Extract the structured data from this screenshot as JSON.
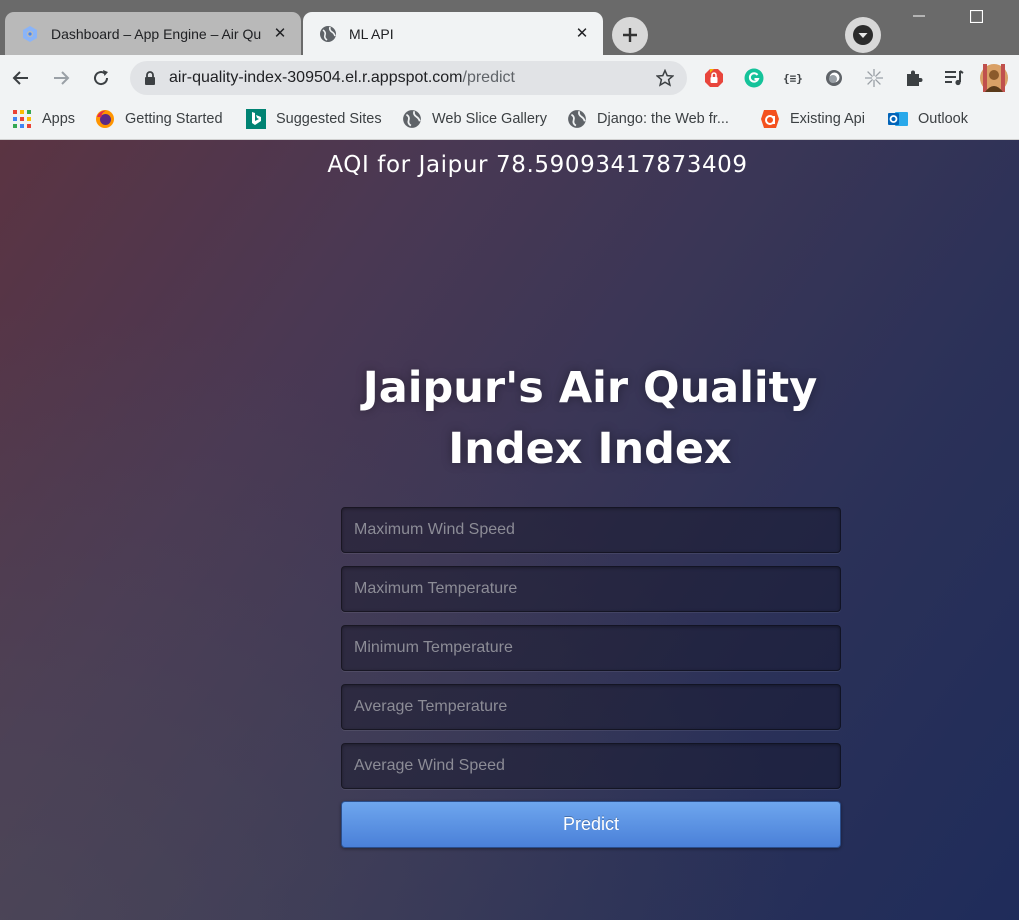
{
  "browser": {
    "tabs": [
      {
        "title": "Dashboard – App Engine – Air Qu",
        "icon": "app-engine-icon",
        "active": false
      },
      {
        "title": "ML API",
        "icon": "globe-icon",
        "active": true
      }
    ],
    "address_bar": {
      "host": "air-quality-index-309504.el.r.appspot.com",
      "path": "/predict"
    },
    "bookmarks": [
      {
        "label": "Apps",
        "icon": "apps-grid-icon"
      },
      {
        "label": "Getting Started",
        "icon": "firefox-icon"
      },
      {
        "label": "Suggested Sites",
        "icon": "bing-icon"
      },
      {
        "label": "Web Slice Gallery",
        "icon": "globe-icon"
      },
      {
        "label": "Django: the Web fr...",
        "icon": "globe-icon"
      },
      {
        "label": "Existing Api",
        "icon": "app-icon"
      },
      {
        "label": "Outlook",
        "icon": "outlook-icon"
      }
    ],
    "extensions": [
      "adblock-icon",
      "grammarly-icon",
      "json-formatter-icon",
      "extension-circle-icon",
      "sparkle-icon",
      "puzzle-icon",
      "media-queue-icon",
      "profile-avatar"
    ]
  },
  "page": {
    "result_text": "AQI for Jaipur 78.59093417873409",
    "heading": "Jaipur's Air Quality Index Index",
    "inputs": {
      "max_wind_speed": "Maximum Wind Speed",
      "max_temperature": "Maximum Temperature",
      "min_temperature": "Minimum Temperature",
      "avg_temperature": "Average Temperature",
      "avg_wind_speed": "Average Wind Speed"
    },
    "predict_label": "Predict"
  },
  "colors": {
    "button": "#4a80d8",
    "background_start": "#5b3442",
    "background_end": "#1f2c5a"
  }
}
